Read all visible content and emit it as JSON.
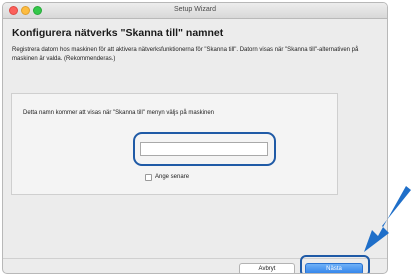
{
  "window": {
    "title": "Setup Wizard"
  },
  "page": {
    "heading": "Konfigurera nätverks \"Skanna till\" namnet",
    "description": "Registrera datorn hos maskinen för att aktivera nätverksfunktionerna för \"Skanna till\". Datorn visas när \"Skanna till\"-alternativen på maskinen är valda. (Rekommenderas.)"
  },
  "panel": {
    "prompt": "Detta namn kommer att visas när \"Skanna till\" menyn väljs på maskinen",
    "name_input_value": "",
    "checkbox_label": "Ange senare",
    "checkbox_checked": false
  },
  "buttons": {
    "cancel_label": "Avbryt",
    "next_label": "Nästa"
  },
  "colors": {
    "highlight": "#1f5aa6",
    "primary_button": "#2f82ea"
  }
}
